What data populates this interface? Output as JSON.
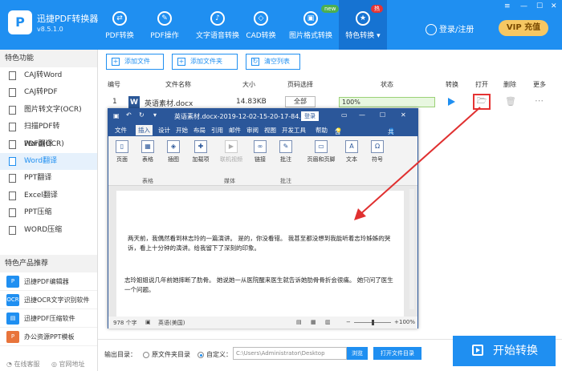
{
  "app": {
    "name": "迅捷PDF转换器",
    "version": "v8.5.1.0",
    "logo": "P"
  },
  "nav": [
    {
      "label": "PDF转换",
      "icon": "convert-icon"
    },
    {
      "label": "PDF操作",
      "icon": "edit-icon"
    },
    {
      "label": "文字语音转换",
      "icon": "audio-icon"
    },
    {
      "label": "CAD转换",
      "icon": "cad-icon"
    },
    {
      "label": "图片格式转换",
      "icon": "image-icon"
    },
    {
      "label": "特色转换 ▾",
      "icon": "star-icon"
    }
  ],
  "badges": {
    "new": "new",
    "hot": "热"
  },
  "header": {
    "login": "登录/注册",
    "vip": "VIP 充值",
    "min": "—",
    "max": "☐",
    "close": "✕",
    "menu": "≡"
  },
  "sidebar": {
    "section1": "特色功能",
    "items": [
      "CAJ转Word",
      "CAJ转PDF",
      "图片转文字(OCR)",
      "扫描PDF转Word(OCR)",
      "PDF翻译",
      "Word翻译",
      "PPT翻译",
      "Excel翻译",
      "PPT压缩",
      "WORD压缩"
    ],
    "section2": "特色产品推荐",
    "products": [
      "迅捷PDF编辑器",
      "迅捷OCR文字识别软件",
      "迅捷PDF压缩软件",
      "办公资源PPT模板"
    ],
    "online": "在线客服",
    "website": "官网地址"
  },
  "toolbar": {
    "add_file": "添加文件",
    "add_folder": "添加文件夹",
    "clear": "清空列表"
  },
  "table": {
    "headers": [
      "编号",
      "文件名称",
      "大小",
      "页码选择",
      "状态",
      "转换",
      "打开",
      "删除",
      "更多"
    ],
    "row": {
      "index": "1",
      "filename": "英语素材.docx",
      "size": "14.83KB",
      "pages": "全部",
      "status": "100%"
    }
  },
  "footer": {
    "output_label": "输出目录：",
    "opt1": "原文件夹目录",
    "opt2": "自定义：",
    "path": "C:\\Users\\Administrator\\Desktop",
    "browse": "浏览",
    "open_folder": "打开文件目录",
    "start": "开始转换"
  },
  "word": {
    "title": "英语素材.docx-2019-12-02-15-20-17-84...",
    "login": "登录",
    "menus": [
      "文件",
      "插入",
      "设计",
      "开始",
      "布局",
      "引用",
      "邮件",
      "审阅",
      "视图",
      "开发工具",
      "帮助",
      "告诉我",
      "共享"
    ],
    "ribbon": {
      "page": "页面",
      "table": "表格",
      "illus": "插图",
      "addin": "加载项",
      "media": "联机视频",
      "link": "链接",
      "comment": "批注",
      "headerfooter": "页眉和页脚",
      "text": "文本",
      "symbol": "符号",
      "g_table": "表格",
      "g_media": "媒体",
      "g_comment": "批注"
    },
    "para1": "两天前，我偶然看到林志玲的一篇演讲。 是的，你没看错。 我甚至都没想到我能听着志玲姊姊的哭诉，看上十分钟的演讲。给我留下了深刻的印象。",
    "para2": "志玲姐姐说几年前她摔断了肋骨。 她说她一从医院醒来医生就告诉她肋骨骨折会很痛。 她只问了医生一个问题。",
    "status_words": "978 个字",
    "status_lang": "英语(美国)",
    "zoom": "100%"
  },
  "colors": {
    "brand": "#1f8ff1",
    "word": "#2b579a",
    "highlight": "#e53333",
    "arrow": "#e03030"
  }
}
